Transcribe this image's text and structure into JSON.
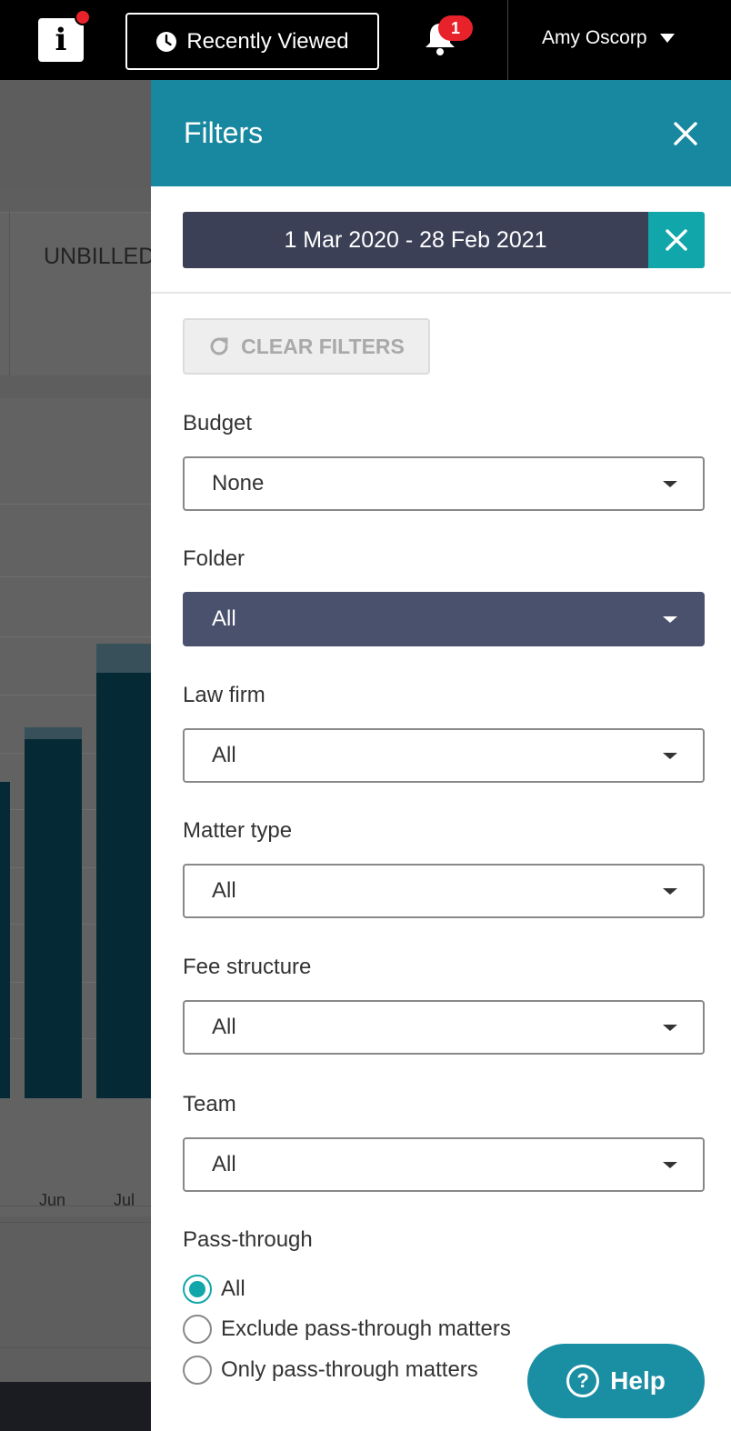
{
  "topbar": {
    "logo_letter": "i",
    "recently_viewed_label": "Recently Viewed",
    "notification_count": "1",
    "user_name": "Amy Oscorp"
  },
  "background": {
    "card_label": "UNBILLED",
    "chart_x_labels": [
      "Jun",
      "Jul"
    ]
  },
  "filters": {
    "title": "Filters",
    "date_range": "1 Mar 2020 - 28 Feb 2021",
    "clear_label": "CLEAR FILTERS",
    "fields": {
      "budget": {
        "label": "Budget",
        "value": "None"
      },
      "folder": {
        "label": "Folder",
        "value": "All"
      },
      "law_firm": {
        "label": "Law firm",
        "value": "All"
      },
      "matter_type": {
        "label": "Matter type",
        "value": "All"
      },
      "fee_structure": {
        "label": "Fee structure",
        "value": "All"
      },
      "team": {
        "label": "Team",
        "value": "All"
      }
    },
    "pass_through": {
      "label": "Pass-through",
      "options": [
        "All",
        "Exclude pass-through matters",
        "Only pass-through matters"
      ],
      "selected": "All"
    }
  },
  "help": {
    "label": "Help"
  },
  "colors": {
    "header_teal": "#1888a0",
    "accent_teal": "#11a6a9",
    "date_bg": "#3c4057",
    "active_select": "#4a516d",
    "badge_red": "#e8222b"
  }
}
